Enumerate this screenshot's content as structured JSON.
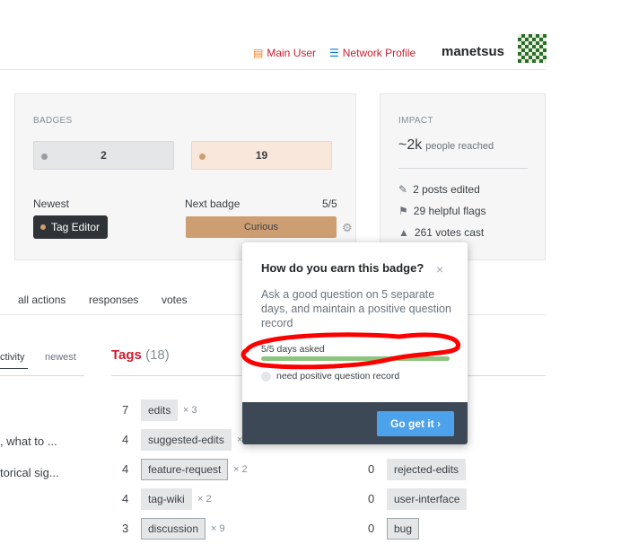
{
  "header": {
    "main_user": "Main User",
    "network_profile": "Network Profile",
    "username": "manetsus"
  },
  "badges": {
    "title": "BADGES",
    "silver": "2",
    "bronze": "19",
    "newest_label": "Newest",
    "newest_badge": "Tag Editor",
    "next_label": "Next badge",
    "next_progress": "5/5",
    "next_badge": "Curious"
  },
  "impact": {
    "title": "IMPACT",
    "reached_value": "~2k",
    "reached_label": "people reached",
    "stats": [
      "2 posts edited",
      "29 helpful flags",
      "261 votes cast"
    ]
  },
  "tabs": [
    "all actions",
    "responses",
    "votes"
  ],
  "left_tabs": [
    "ctivity",
    "newest"
  ],
  "left_items": [
    ", what to ...",
    "torical sig..."
  ],
  "tags": {
    "title": "Tags",
    "count": "(18)",
    "left": [
      {
        "score": "7",
        "name": "edits",
        "mult": "× 3",
        "meta": false
      },
      {
        "score": "4",
        "name": "suggested-edits",
        "mult": "×",
        "meta": false
      },
      {
        "score": "4",
        "name": "feature-request",
        "mult": "× 2",
        "meta": true
      },
      {
        "score": "4",
        "name": "tag-wiki",
        "mult": "× 2",
        "meta": false
      },
      {
        "score": "3",
        "name": "discussion",
        "mult": "× 9",
        "meta": true
      }
    ],
    "right": [
      {
        "score": "0",
        "name": "rejected-edits",
        "meta": false
      },
      {
        "score": "0",
        "name": "user-interface",
        "meta": false
      },
      {
        "score": "0",
        "name": "bug",
        "meta": true
      }
    ]
  },
  "popup": {
    "title": "How do you earn this badge?",
    "close": "×",
    "description": "Ask a good question on 5 separate days, and maintain a positive question record",
    "progress_label": "5/5 days asked",
    "progress_value": 1.0,
    "requirement": "need positive question record",
    "cta": "Go get it ›"
  },
  "colors": {
    "accent": "#c91d2e",
    "bronze": "#cd9e72",
    "progress": "#8cc57f",
    "cta": "#4ca3eb",
    "footer": "#3d4856"
  }
}
